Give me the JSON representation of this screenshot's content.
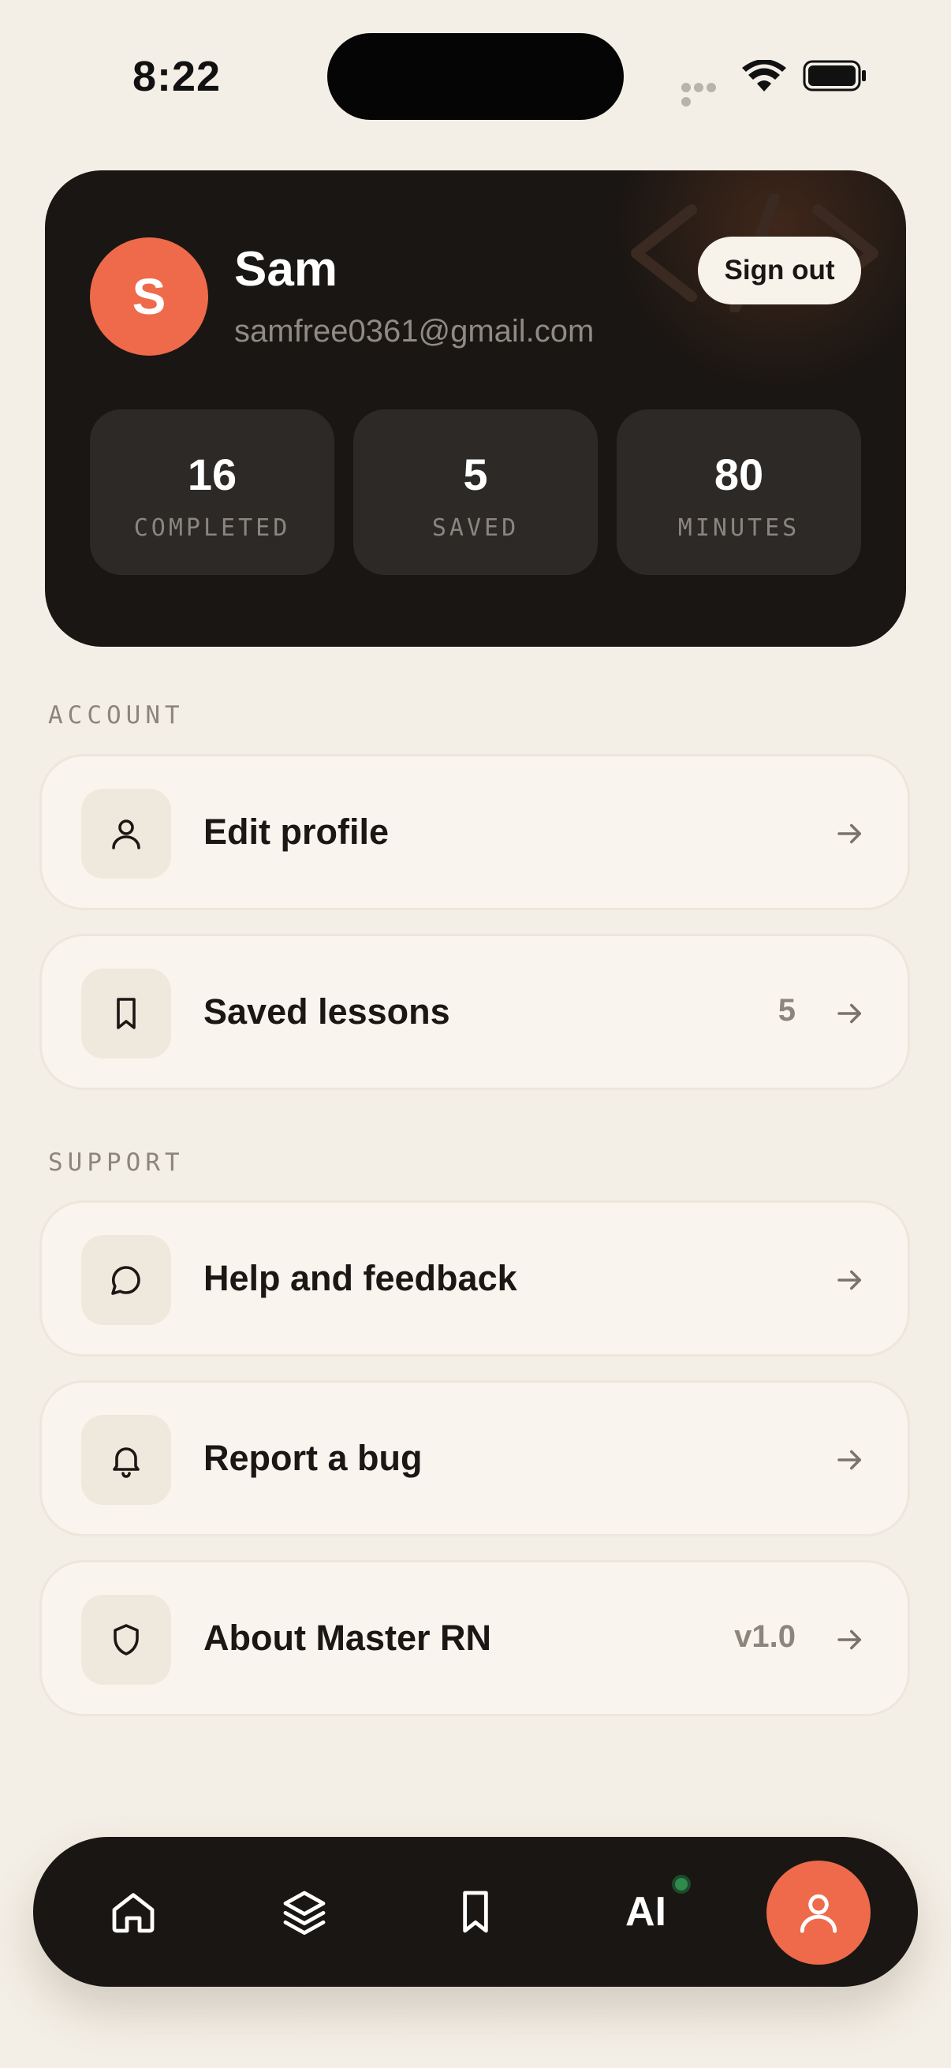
{
  "status_bar": {
    "time": "8:22"
  },
  "profile": {
    "avatar_initial": "S",
    "name": "Sam",
    "email": "samfree0361@gmail.com",
    "sign_out_label": "Sign out",
    "stats": [
      {
        "value": "16",
        "label": "COMPLETED"
      },
      {
        "value": "5",
        "label": "SAVED"
      },
      {
        "value": "80",
        "label": "MINUTES"
      }
    ]
  },
  "sections": {
    "account": {
      "title": "ACCOUNT",
      "items": [
        {
          "label": "Edit profile",
          "icon": "user-icon",
          "meta": ""
        },
        {
          "label": "Saved lessons",
          "icon": "bookmark-icon",
          "meta": "5"
        }
      ]
    },
    "support": {
      "title": "SUPPORT",
      "items": [
        {
          "label": "Help and feedback",
          "icon": "chat-bubble-icon",
          "meta": ""
        },
        {
          "label": "Report a bug",
          "icon": "bell-icon",
          "meta": ""
        },
        {
          "label": "About Master RN",
          "icon": "shield-icon",
          "meta": "v1.0"
        }
      ]
    }
  },
  "bottom_nav": {
    "items": [
      {
        "name": "home",
        "icon": "home-icon"
      },
      {
        "name": "lessons",
        "icon": "layers-icon"
      },
      {
        "name": "saved",
        "icon": "bookmark-icon"
      },
      {
        "name": "ai",
        "label": "AI"
      },
      {
        "name": "profile",
        "icon": "user-icon",
        "active": true
      }
    ]
  },
  "colors": {
    "background": "#f4efe6",
    "card_dark": "#1a1613",
    "accent": "#ee6a4b",
    "row_background": "#f9f5ee",
    "muted_text": "#8d857c",
    "ai_status_dot": "#2f8a4c"
  }
}
